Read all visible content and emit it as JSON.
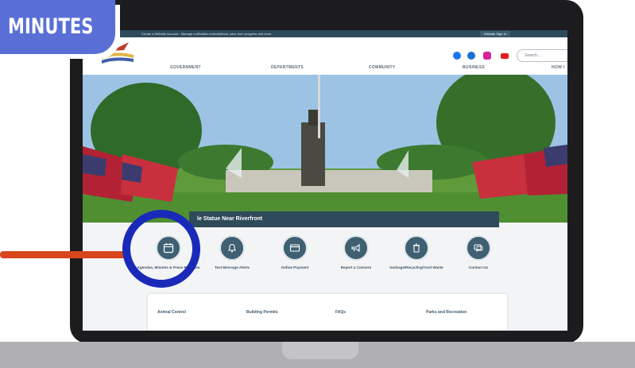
{
  "badge": {
    "label": "MINUTES"
  },
  "topbar": {
    "note": "Create a Website Account - Manage notification subscriptions, save form progress and more.",
    "signin": "Website Sign In"
  },
  "search": {
    "placeholder": "Search..."
  },
  "nav": [
    "GOVERNMENT",
    "DEPARTMENTS",
    "COMMUNITY",
    "BUSINESS",
    "HOW I"
  ],
  "hero": {
    "caption": "le Statue Near Riverfront"
  },
  "quick_links": [
    {
      "label": "Agendas, Minutes & Press Releases",
      "icon": "calendar-icon"
    },
    {
      "label": "Text Message Alerts",
      "icon": "bell-icon"
    },
    {
      "label": "Online Payment",
      "icon": "credit-card-icon"
    },
    {
      "label": "Report a Concern",
      "icon": "megaphone-icon"
    },
    {
      "label": "Garbage/Recycling/Yard Waste",
      "icon": "trash-icon"
    },
    {
      "label": "Contact Us",
      "icon": "chat-icon"
    }
  ],
  "departments": [
    "Animal Control",
    "Building Permits",
    "FAQs",
    "Parks and Recreation"
  ],
  "colors": {
    "brand_dark": "#2f4a5a",
    "icon_circle": "#3e6072",
    "badge": "#5a6fd6",
    "highlight_ring": "#1a2ab8",
    "pointer": "#d9451c"
  }
}
